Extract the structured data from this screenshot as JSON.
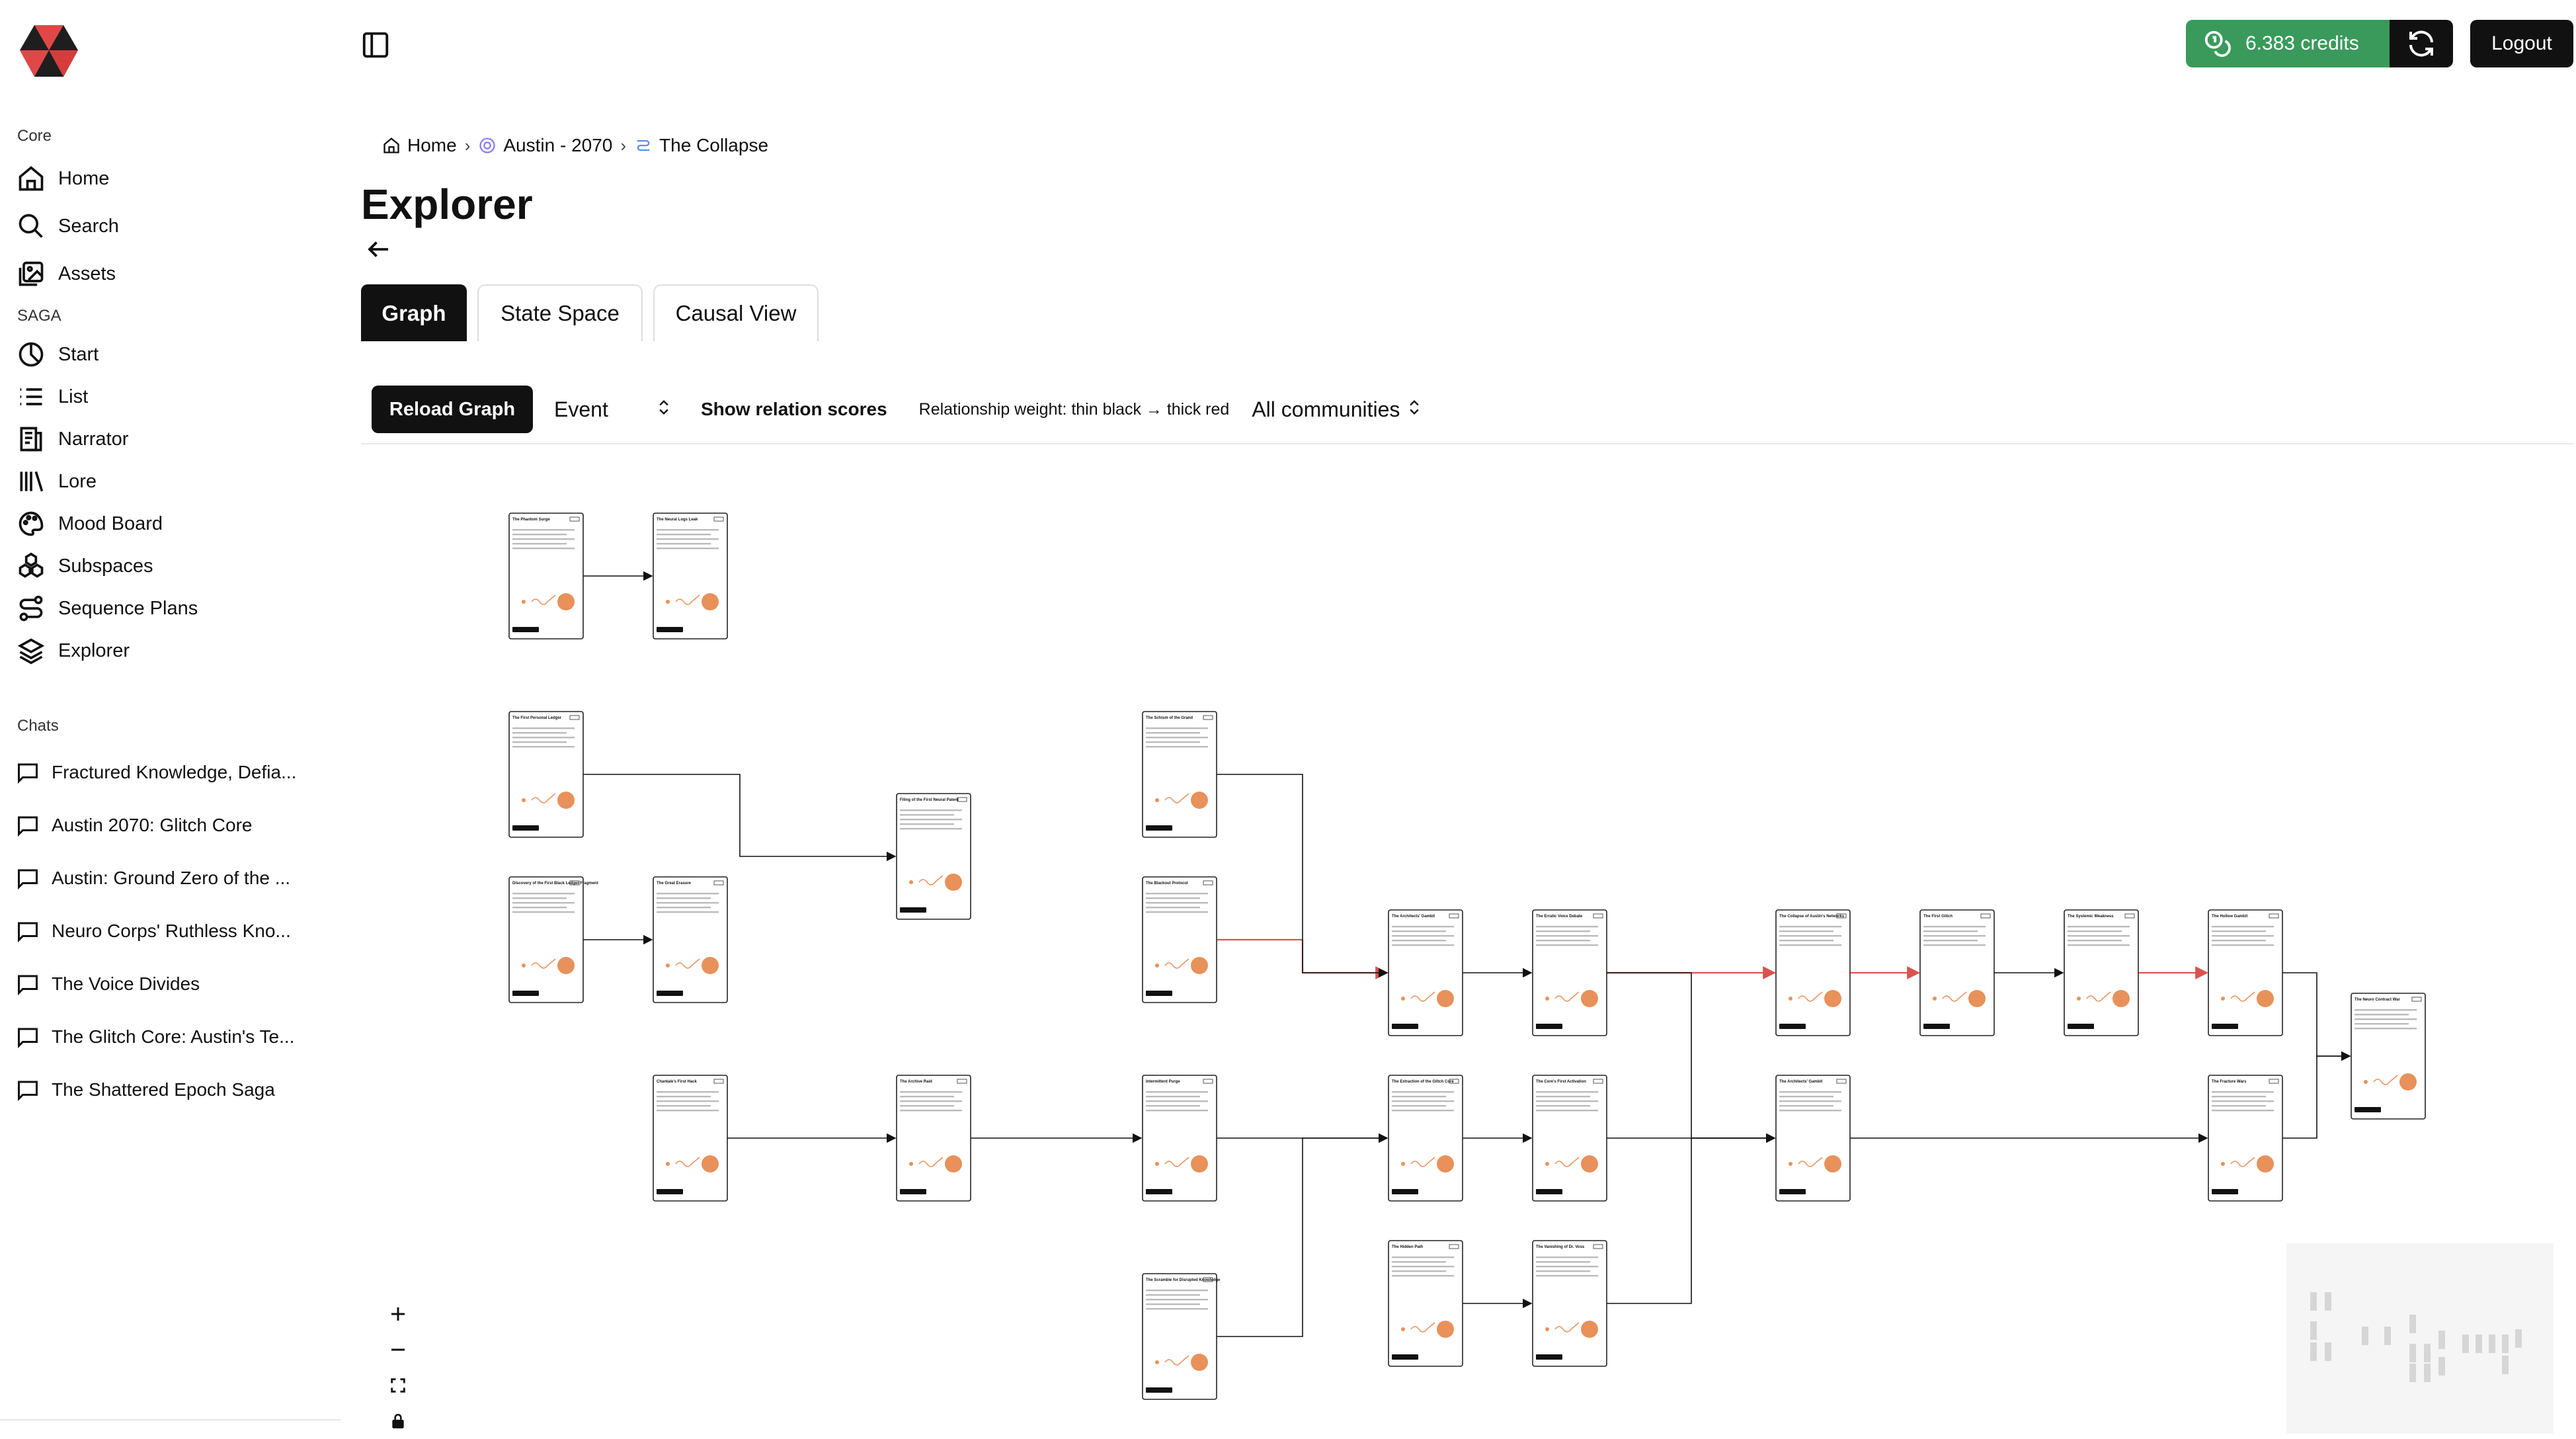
{
  "sidebar": {
    "core_title": "Core",
    "core_items": [
      {
        "label": "Home",
        "icon": "home-icon"
      },
      {
        "label": "Search",
        "icon": "search-icon"
      },
      {
        "label": "Assets",
        "icon": "assets-icon"
      }
    ],
    "saga_title": "SAGA",
    "saga_items": [
      {
        "label": "Start",
        "icon": "start-icon"
      },
      {
        "label": "List",
        "icon": "list-icon"
      },
      {
        "label": "Narrator",
        "icon": "narrator-icon"
      },
      {
        "label": "Lore",
        "icon": "lore-icon"
      },
      {
        "label": "Mood Board",
        "icon": "palette-icon"
      },
      {
        "label": "Subspaces",
        "icon": "subspaces-icon"
      },
      {
        "label": "Sequence Plans",
        "icon": "sequence-icon"
      },
      {
        "label": "Explorer",
        "icon": "layers-icon"
      }
    ],
    "chats_title": "Chats",
    "chats": [
      "Fractured Knowledge, Defia...",
      "Austin 2070: Glitch Core",
      "Austin: Ground Zero of the ...",
      "Neuro Corps' Ruthless Kno...",
      "The Voice Divides",
      "The Glitch Core: Austin's Te...",
      "The Shattered Epoch Saga"
    ]
  },
  "header": {
    "credits_label": "6.383 credits",
    "logout_label": "Logout",
    "accent": "#3a9a5b"
  },
  "breadcrumb": {
    "home": "Home",
    "saga": "Austin - 2070",
    "page": "The Collapse"
  },
  "page": {
    "title": "Explorer"
  },
  "tabs": [
    "Graph",
    "State Space",
    "Causal View"
  ],
  "toolbar": {
    "reload_label": "Reload Graph",
    "entity_select": "Event",
    "relation_scores_label": "Show relation scores",
    "weight_legend": "Relationship weight: thin black → thick red",
    "community_select": "All communities"
  },
  "graph": {
    "node_card_color": "#ffffff",
    "accent_dot": "#e8915a",
    "strong_edge": "#d9534f",
    "weak_edge": "#111111",
    "nodes": [
      {
        "title": "The Phantom Surge"
      },
      {
        "title": "The Neural Logs Leak"
      },
      {
        "title": "The First Personal Ledger"
      },
      {
        "title": "Discovery of the First Black Ledger Fragment"
      },
      {
        "title": "The Great Erasure"
      },
      {
        "title": "Filing of the First Neural Patent"
      },
      {
        "title": "The Schism of the Grand"
      },
      {
        "title": "The Blackout Protocol"
      },
      {
        "title": "The Architects' Gambit"
      },
      {
        "title": "The Erratic Voice Debate"
      },
      {
        "title": "The Collapse of Austin's Networks"
      },
      {
        "title": "The First Glitch"
      },
      {
        "title": "The Systemic Weakness"
      },
      {
        "title": "The Hollow Gambit"
      },
      {
        "title": "The Neuro Contract War"
      },
      {
        "title": "Chantale's First Hack"
      },
      {
        "title": "The Archive Raid"
      },
      {
        "title": "Intermittent Purge"
      },
      {
        "title": "The Extraction of the Glitch Core"
      },
      {
        "title": "The Core's First Activation"
      },
      {
        "title": "The Architects' Gambit"
      },
      {
        "title": "The Fracture Wars"
      },
      {
        "title": "The Hidden Path"
      },
      {
        "title": "The Vanishing of Dr. Voss"
      },
      {
        "title": "The Scramble for Disrupted Knowledge"
      }
    ]
  }
}
